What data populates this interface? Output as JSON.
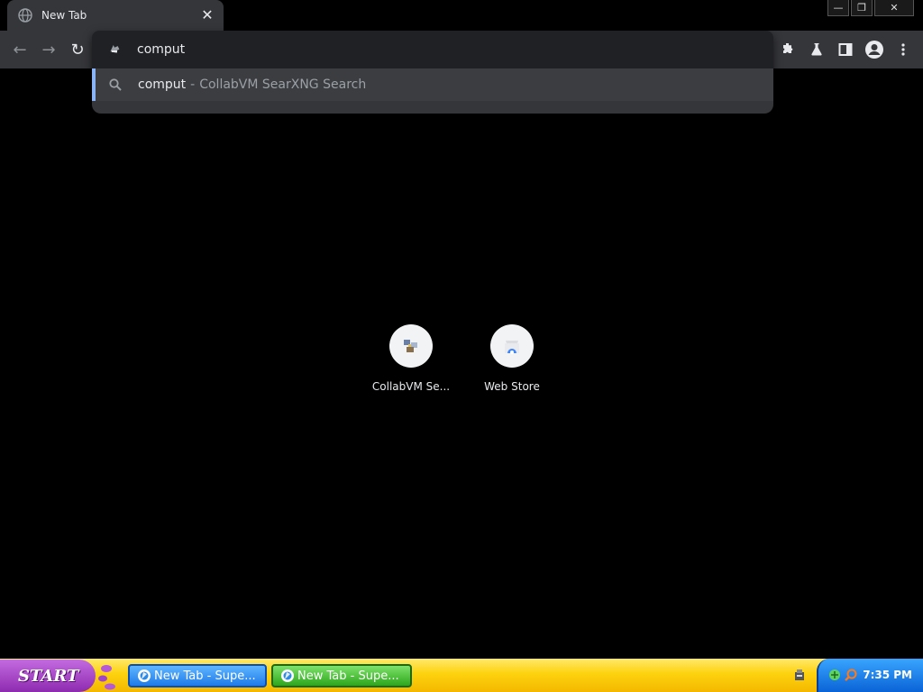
{
  "browser": {
    "tab": {
      "title": "New Tab",
      "close_glyph": "✕",
      "icon": "globe-icon"
    },
    "window_controls": {
      "minimize": "—",
      "restore": "❐",
      "close": "✕"
    },
    "toolbar": {
      "back_glyph": "←",
      "forward_glyph": "→",
      "reload_glyph": "↻",
      "right_icons": [
        "extensions-icon",
        "labs-flask-icon",
        "side-panel-icon",
        "profile-icon",
        "menu-dots-icon"
      ]
    },
    "omnibox": {
      "value": "comput",
      "suggestion": {
        "query": "comput",
        "separator": "-",
        "engine": "CollabVM SearXNG Search"
      }
    }
  },
  "shortcuts": [
    {
      "label": "CollabVM Se...",
      "icon": "collabvm-icon"
    },
    {
      "label": "Web Store",
      "icon": "web-store-icon"
    }
  ],
  "taskbar": {
    "start_label": "START",
    "buttons": [
      {
        "label": "New Tab - Supe..."
      },
      {
        "label": "New Tab - Supe..."
      }
    ],
    "clock": "7:35 PM"
  },
  "colors": {
    "accent": "#8ab4f8",
    "chrome_bg": "#35363a",
    "page_bg": "#000000",
    "taskbar": "#fdd20e",
    "start": "#8e2bb0"
  }
}
